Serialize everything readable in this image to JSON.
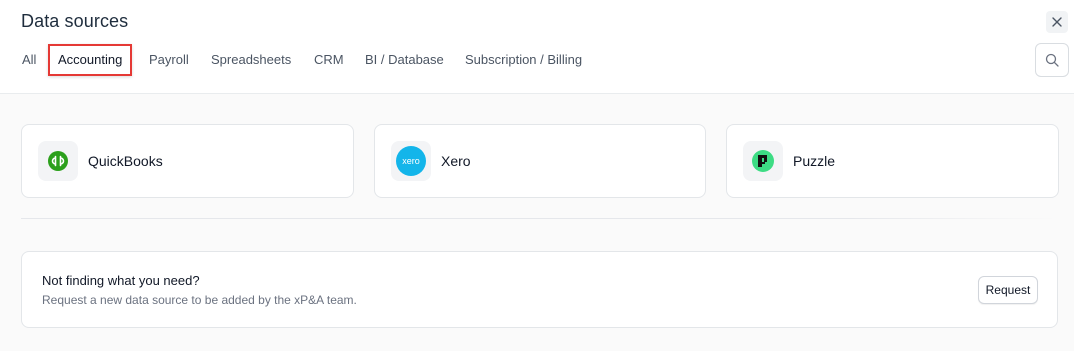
{
  "header": {
    "title": "Data sources",
    "close_icon": "close-icon",
    "search_icon": "search-icon"
  },
  "tabs": [
    {
      "label": "All",
      "active": false
    },
    {
      "label": "Accounting",
      "active": true
    },
    {
      "label": "Payroll",
      "active": false
    },
    {
      "label": "Spreadsheets",
      "active": false
    },
    {
      "label": "CRM",
      "active": false
    },
    {
      "label": "BI / Database",
      "active": false
    },
    {
      "label": "Subscription / Billing",
      "active": false
    }
  ],
  "sources": [
    {
      "name": "QuickBooks",
      "icon": "quickbooks-logo",
      "color": "#2ca01c"
    },
    {
      "name": "Xero",
      "icon": "xero-logo",
      "color": "#13b5ea"
    },
    {
      "name": "Puzzle",
      "icon": "puzzle-logo",
      "color": "#3ddc84"
    }
  ],
  "request": {
    "title": "Not finding what you need?",
    "subtitle": "Request a new data source to be added by the xP&A team.",
    "button_label": "Request"
  },
  "colors": {
    "active_tab_border": "#e53935",
    "background": "#fafafa"
  }
}
